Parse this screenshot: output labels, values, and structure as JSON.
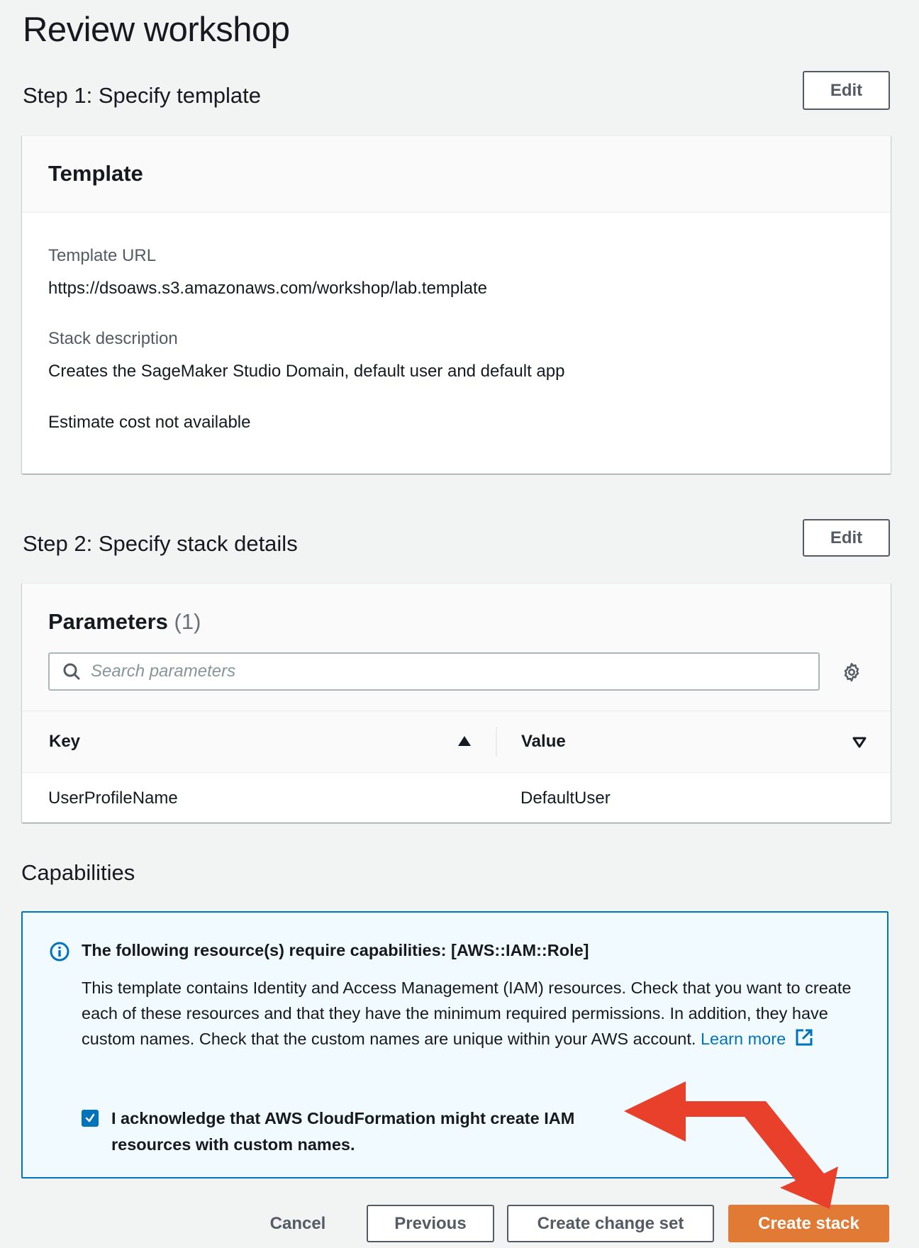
{
  "page": {
    "title": "Review workshop"
  },
  "step1": {
    "heading": "Step 1: Specify template",
    "edit_label": "Edit",
    "card_title": "Template",
    "template_url_label": "Template URL",
    "template_url_value": "https://dsoaws.s3.amazonaws.com/workshop/lab.template",
    "stack_description_label": "Stack description",
    "stack_description_value": "Creates the SageMaker Studio Domain, default user and default app",
    "estimate_cost": "Estimate cost not available"
  },
  "step2": {
    "heading": "Step 2: Specify stack details",
    "edit_label": "Edit",
    "card_title": "Parameters",
    "count": "(1)",
    "search": {
      "placeholder": "Search parameters",
      "value": ""
    },
    "columns": [
      {
        "label": "Key",
        "sort": "ascending"
      },
      {
        "label": "Value",
        "sort": "none"
      }
    ],
    "rows": [
      {
        "key": "UserProfileName",
        "value": "DefaultUser"
      }
    ]
  },
  "capabilities": {
    "heading": "Capabilities",
    "info_title": "The following resource(s) require capabilities: [AWS::IAM::Role]",
    "info_body": "This template contains Identity and Access Management (IAM) resources. Check that you want to create each of these resources and that they have the minimum required permissions. In addition, they have custom names. Check that the custom names are unique within your AWS account.",
    "learn_more": "Learn more",
    "acknowledge_checked": true,
    "acknowledge_label": "I acknowledge that AWS CloudFormation might create IAM resources with custom names."
  },
  "footer": {
    "cancel": "Cancel",
    "previous": "Previous",
    "create_change_set": "Create change set",
    "create_stack": "Create stack"
  },
  "colors": {
    "primary_button": "#e07a35",
    "info_blue": "#0073bb",
    "annotation_arrow": "#e8402a"
  }
}
